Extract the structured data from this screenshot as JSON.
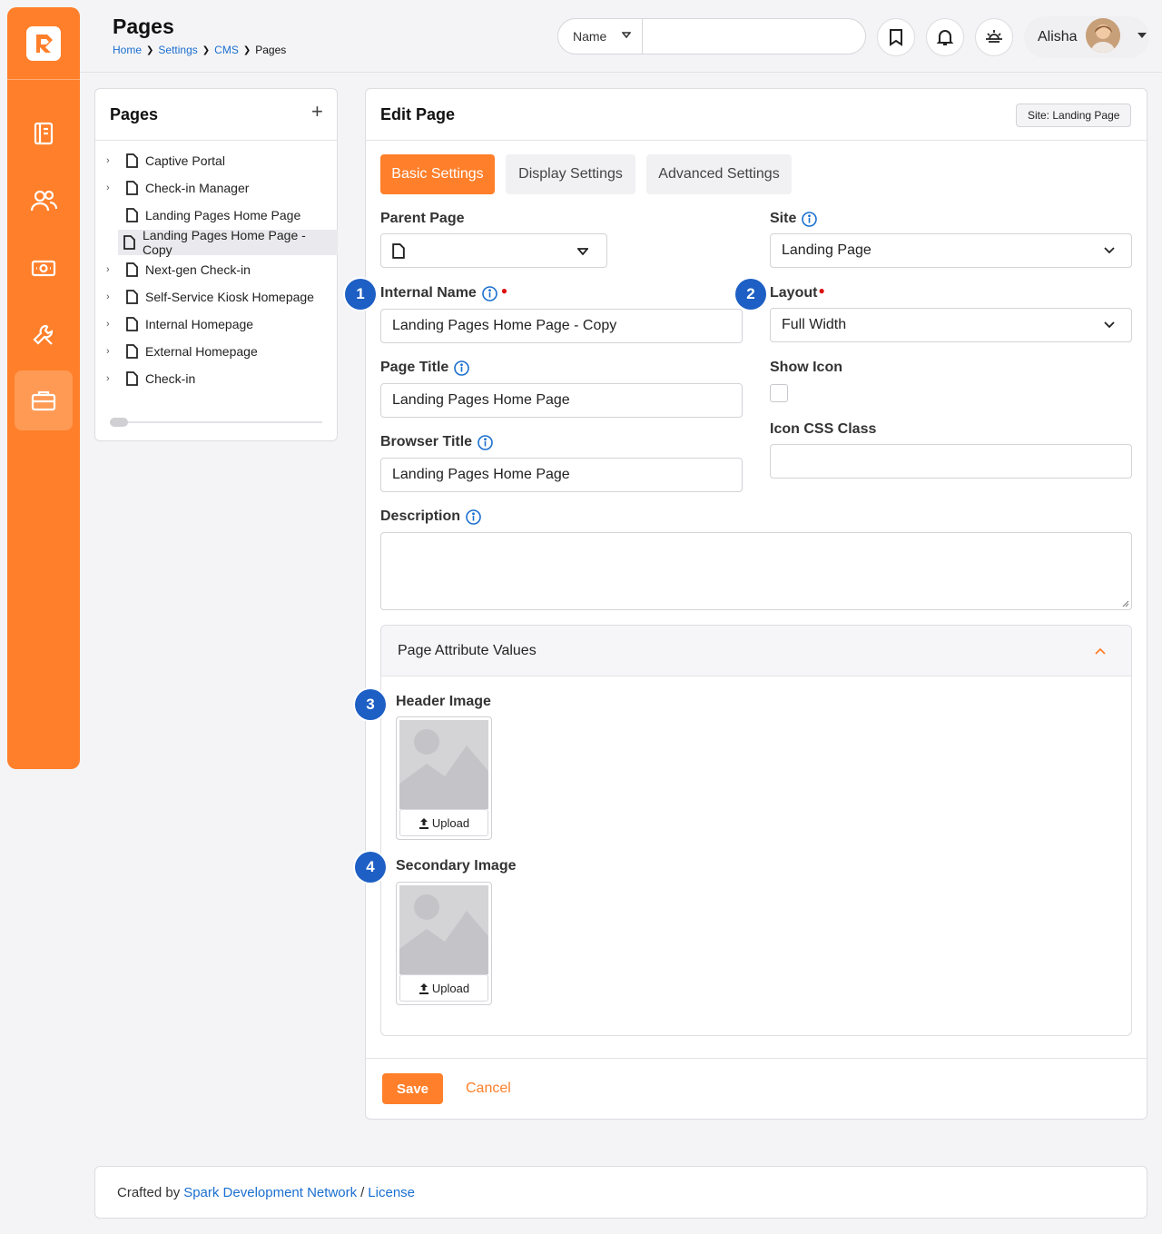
{
  "header": {
    "title": "Pages",
    "breadcrumbs": [
      "Home",
      "Settings",
      "CMS",
      "Pages"
    ],
    "search_type": "Name",
    "search_value": "",
    "user_name": "Alisha"
  },
  "sidebar": {
    "items": [
      {
        "icon": "book-icon"
      },
      {
        "icon": "people-icon"
      },
      {
        "icon": "money-icon"
      },
      {
        "icon": "wrench-icon"
      },
      {
        "icon": "briefcase-icon",
        "active": true
      }
    ]
  },
  "tree": {
    "title": "Pages",
    "add_label": "+",
    "items": [
      {
        "label": "Captive Portal",
        "expandable": true
      },
      {
        "label": "Check-in Manager",
        "expandable": true
      },
      {
        "label": "Landing Pages Home Page",
        "expandable": false
      },
      {
        "label": "Landing Pages Home Page - Copy",
        "expandable": false,
        "selected": true
      },
      {
        "label": "Next-gen Check-in",
        "expandable": true
      },
      {
        "label": "Self-Service Kiosk Homepage",
        "expandable": true
      },
      {
        "label": "Internal Homepage",
        "expandable": true
      },
      {
        "label": "External Homepage",
        "expandable": true
      },
      {
        "label": "Check-in",
        "expandable": true
      }
    ]
  },
  "edit": {
    "title": "Edit Page",
    "site_badge": "Site: Landing Page",
    "tabs": [
      "Basic Settings",
      "Display Settings",
      "Advanced Settings"
    ],
    "parent_page_label": "Parent Page",
    "site_label": "Site",
    "site_value": "Landing Page",
    "internal_name_label": "Internal Name",
    "internal_name_value": "Landing Pages Home Page - Copy",
    "layout_label": "Layout",
    "layout_value": "Full Width",
    "page_title_label": "Page Title",
    "page_title_value": "Landing Pages Home Page",
    "show_icon_label": "Show Icon",
    "icon_css_label": "Icon CSS Class",
    "icon_css_value": "",
    "browser_title_label": "Browser Title",
    "browser_title_value": "Landing Pages Home Page",
    "description_label": "Description",
    "description_value": "",
    "attr_title": "Page Attribute Values",
    "header_image_label": "Header Image",
    "secondary_image_label": "Secondary Image",
    "upload_label": "Upload",
    "save_label": "Save",
    "cancel_label": "Cancel",
    "callouts": [
      "1",
      "2",
      "3",
      "4"
    ]
  },
  "footer": {
    "prefix": "Crafted by",
    "link1": "Spark Development Network",
    "sep": "/",
    "link2": "License"
  },
  "colors": {
    "accent": "#ff7f2a",
    "link": "#1a6fcf",
    "callout": "#1d5fc4",
    "required": "#dd1111"
  }
}
